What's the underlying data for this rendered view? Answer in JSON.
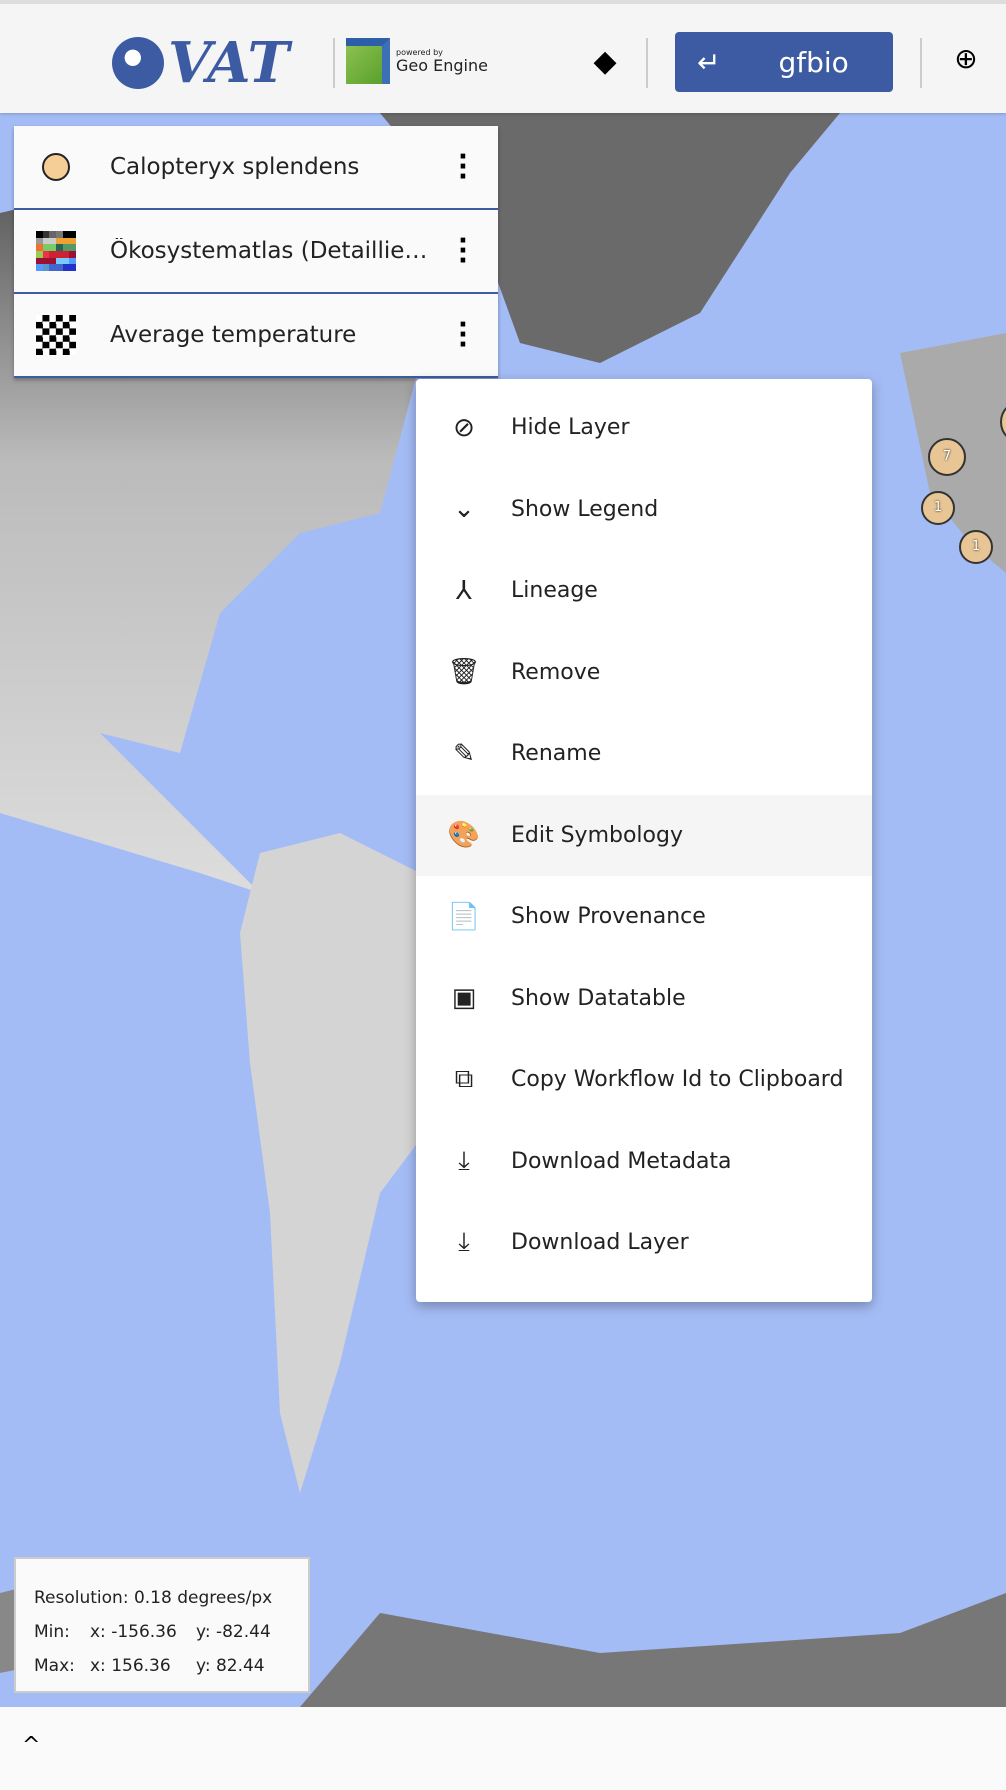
{
  "header": {
    "logo": "VAT",
    "powered_by": "powered by",
    "geo_engine": "Geo Engine",
    "back_label": "gfbio",
    "back_icon": "↵",
    "layers_icon": "layers-icon",
    "zoom_icon": "zoom-in-icon"
  },
  "layers": [
    {
      "name": "Calopteryx splendens",
      "icon": "point-symbol-icon",
      "color": "#f5cd96"
    },
    {
      "name": "Ökosystematlas (Detaillierte Klassen)",
      "icon": "raster-colormap-icon"
    },
    {
      "name": "Average temperature",
      "icon": "checkerboard-icon"
    }
  ],
  "context_menu": [
    {
      "label": "Hide Layer",
      "icon": "visibility-off-icon",
      "glyph": "⊘"
    },
    {
      "label": "Show Legend",
      "icon": "chevron-down-icon",
      "glyph": "⌄"
    },
    {
      "label": "Lineage",
      "icon": "merge-icon",
      "glyph": "⅄"
    },
    {
      "label": "Remove",
      "icon": "trash-icon",
      "glyph": "🗑"
    },
    {
      "label": "Rename",
      "icon": "pencil-icon",
      "glyph": "✎"
    },
    {
      "label": "Edit Symbology",
      "icon": "palette-icon",
      "glyph": "🎨"
    },
    {
      "label": "Show Provenance",
      "icon": "document-icon",
      "glyph": "📄"
    },
    {
      "label": "Show Datatable",
      "icon": "table-window-icon",
      "glyph": "▣"
    },
    {
      "label": "Copy Workflow Id to Clipboard",
      "icon": "copy-icon",
      "glyph": "⧉"
    },
    {
      "label": "Download Metadata",
      "icon": "download-icon",
      "glyph": "⤓"
    },
    {
      "label": "Download Layer",
      "icon": "download-icon",
      "glyph": "⤓"
    }
  ],
  "map_markers": [
    "7",
    "1",
    "1"
  ],
  "info": {
    "resolution": "Resolution: 0.18 degrees/px",
    "min_label": "Min:",
    "min_x": "x: -156.36",
    "min_y": "y: -82.44",
    "max_label": "Max:",
    "max_x": "x: 156.36",
    "max_y": "y: 82.44"
  },
  "bottom": {
    "expand_icon": "chevron-up-icon",
    "expand_glyph": "^"
  },
  "colors": {
    "accent": "#3d5ba3",
    "water": "#a4bcf5",
    "marker": "#e8c594"
  }
}
